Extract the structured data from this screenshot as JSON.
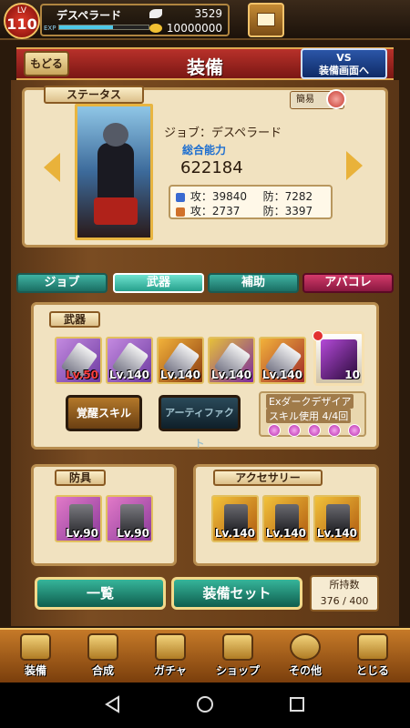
{
  "player": {
    "lv_label": "LV",
    "level": "110",
    "name": "デスペラード",
    "exp_label": "EXP",
    "exp_fraction": 0.6,
    "crystals": "3529",
    "gold": "10000000"
  },
  "header": {
    "back": "もどる",
    "title": "装備",
    "vs_line1": "VS",
    "vs_line2": "装備画面へ"
  },
  "status": {
    "tab": "ステータス",
    "simple": "簡易",
    "job": "ジョブ：デスペラード",
    "power_label": "総合能力",
    "power": "622184",
    "row1_a": "攻：39840",
    "row1_b": "防：7282",
    "row2_a": "攻：2737",
    "row2_b": "防：3397"
  },
  "tabs": {
    "job": "ジョブ",
    "weapon": "武器",
    "support": "補助",
    "abacole": "アバコレ"
  },
  "weapons": {
    "tab": "武器",
    "items": [
      {
        "lv": "Lv.50",
        "lv_color": "#e03030"
      },
      {
        "lv": "Lv.140",
        "lv_color": "#ffffff"
      },
      {
        "lv": "Lv.140",
        "lv_color": "#ffffff"
      },
      {
        "lv": "Lv.140",
        "lv_color": "#ffffff"
      },
      {
        "lv": "Lv.140",
        "lv_color": "#ffffff"
      }
    ],
    "special_lv": "10",
    "skill_btn": "覚醒スキル",
    "artifact_btn": "アーティファクト",
    "skill_name": "Exダークデザイア",
    "skill_use": "スキル使用 4/4回"
  },
  "armor": {
    "tab": "防具",
    "items": [
      {
        "lv": "Lv.90"
      },
      {
        "lv": "Lv.90"
      }
    ]
  },
  "accessory": {
    "tab": "アクセサリー",
    "items": [
      {
        "lv": "Lv.140"
      },
      {
        "lv": "Lv.140"
      },
      {
        "lv": "Lv.140"
      }
    ]
  },
  "buttons": {
    "list": "一覧",
    "set": "装備セット",
    "holding_label": "所持数",
    "holding_val": "376 / 400"
  },
  "nav": [
    "装備",
    "合成",
    "ガチャ",
    "ショップ",
    "その他",
    "とじる"
  ],
  "icons": [
    "crystal-icon",
    "gold-coin-icon",
    "mail-icon",
    "back-icon",
    "triangle-back-icon",
    "circle-home-icon",
    "square-recents-icon"
  ]
}
